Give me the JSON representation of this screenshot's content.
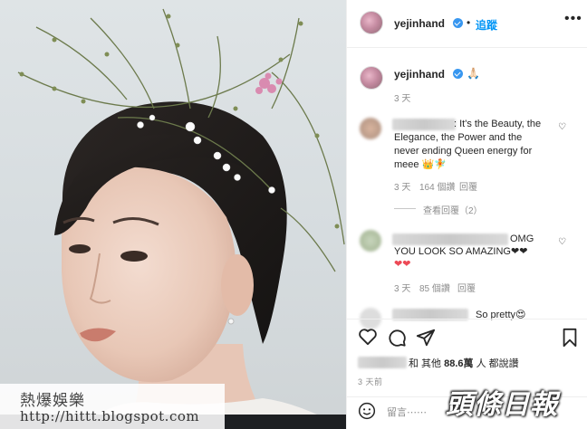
{
  "post": {
    "author": "yejinhand",
    "follow_label": "追蹤",
    "separator": "•",
    "more_icon": "more-horizontal-icon",
    "caption": "🙏🏻",
    "caption_time": "3 天"
  },
  "comments": [
    {
      "text": ": It's the Beauty, the Elegance, the Power and the never ending Queen energy for meee 👑🧚",
      "lines": [
        ": It's the Beauty, the",
        "Elegance, the Power and the",
        "never ending Queen energy for",
        "meee 👑🧚"
      ],
      "time": "3 天",
      "likes": "164 個讚",
      "reply_label": "回覆",
      "view_replies": "查看回覆（2）"
    },
    {
      "text": "OMG YOU LOOK SO AMAZING❤❤ ❤❤",
      "lines": [
        "OMG",
        "YOU LOOK SO AMAZING❤❤",
        "❤❤"
      ],
      "time": "3 天",
      "likes": "85 個讚",
      "reply_label": "回覆"
    },
    {
      "text": "So pretty😍",
      "lines": [
        "So pretty😍"
      ],
      "time": "",
      "likes": "",
      "reply_label": ""
    }
  ],
  "actions": {
    "like_icon": "heart-icon",
    "comment_icon": "comment-icon",
    "share_icon": "paper-plane-icon",
    "save_icon": "bookmark-icon"
  },
  "likes_summary": {
    "prefix": "和 其他 ",
    "count": "88.6萬",
    "suffix": " 人 都說讚"
  },
  "post_time": "3 天前",
  "comment_box": {
    "placeholder": "留言⋯⋯",
    "emoji_icon": "smiley-icon"
  },
  "watermarks": {
    "left_title": "熱爆娛樂",
    "left_url": "http://hittt.blogspot.com",
    "right_logo": "頭條日報"
  },
  "colors": {
    "accent": "#0095f6",
    "verified": "#3897f0",
    "heart_red": "#ed4956"
  }
}
